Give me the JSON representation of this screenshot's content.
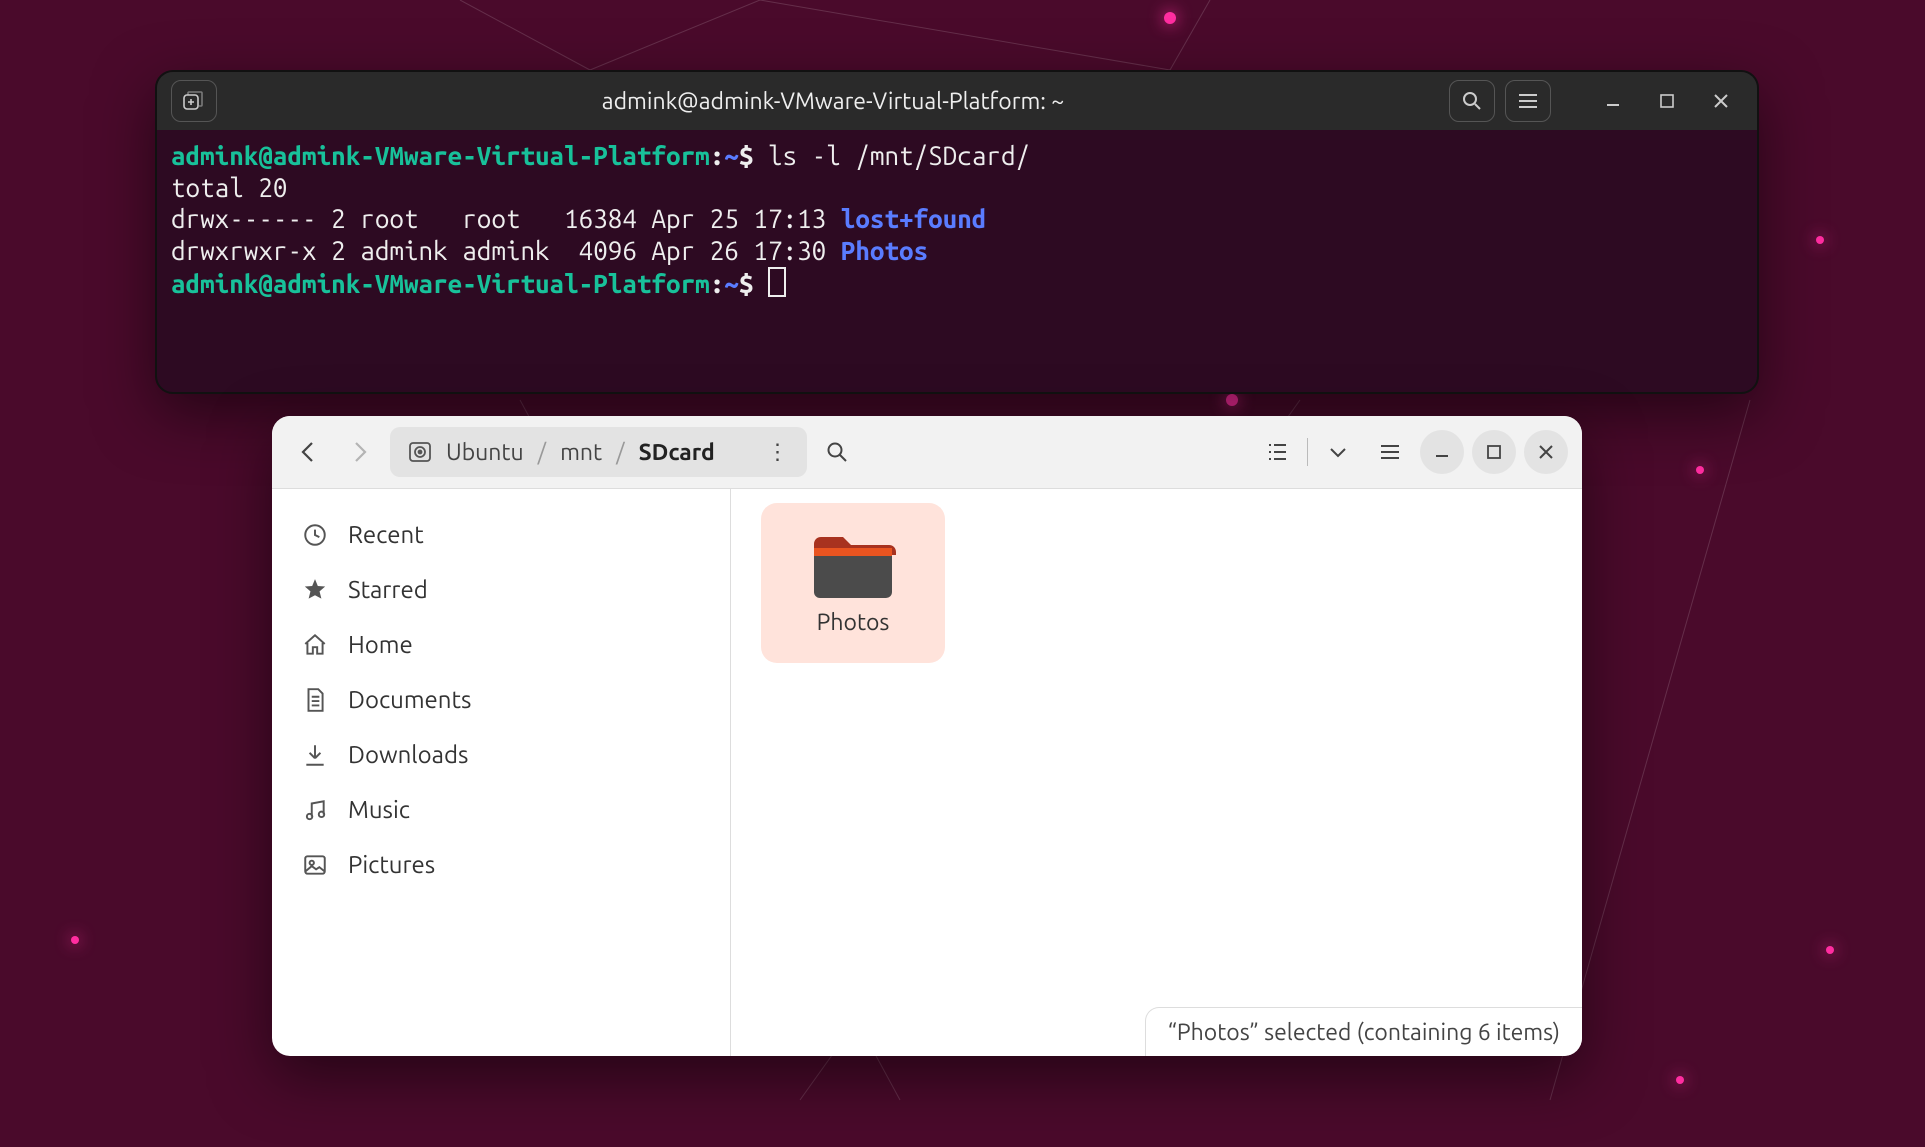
{
  "terminal": {
    "title": "admink@admink-VMware-Virtual-Platform: ~",
    "prompt_user": "admink@admink-VMware-Virtual-Platform",
    "prompt_sep": ":",
    "prompt_path": "~",
    "prompt_dollar": "$",
    "cmd1": "ls -l /mnt/SDcard/",
    "total": "total 20",
    "row1_perm": "drwx------ 2 root   root   16384 Apr 25 17:13 ",
    "row1_name": "lost+found",
    "row2_perm": "drwxrwxr-x 2 admink admink  4096 Apr 26 17:30 ",
    "row2_name": "Photos"
  },
  "files": {
    "breadcrumb": [
      "Ubuntu",
      "mnt",
      "SDcard"
    ],
    "sidebar": [
      "Recent",
      "Starred",
      "Home",
      "Documents",
      "Downloads",
      "Music",
      "Pictures"
    ],
    "folder": "Photos",
    "status": "“Photos” selected  (containing 6 items)"
  }
}
